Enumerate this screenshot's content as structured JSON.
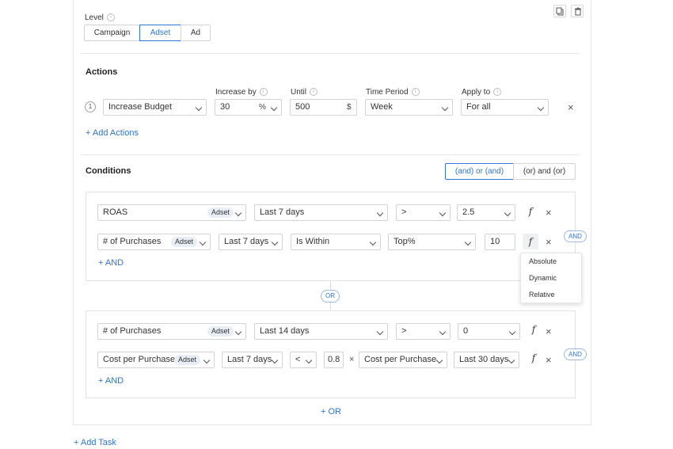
{
  "level": {
    "label": "Level",
    "options": [
      "Campaign",
      "Adset",
      "Ad"
    ],
    "selected": "Adset"
  },
  "actions": {
    "title": "Actions",
    "headers": {
      "increase_by": "Increase by",
      "until": "Until",
      "time_period": "Time Period",
      "apply_to": "Apply to"
    },
    "row": {
      "number": "1",
      "action": "Increase Budget",
      "increase_value": "30",
      "increase_unit": "%",
      "until_value": "500",
      "until_unit": "$",
      "time_period": "Week",
      "apply_to": "For all"
    },
    "add_label": "+ Add Actions"
  },
  "conditions": {
    "title": "Conditions",
    "toggle": {
      "option1": "(and) or (and)",
      "option2": "(or) and (or)",
      "selected": "(and) or (and)"
    },
    "group1": {
      "row1": {
        "metric": "ROAS",
        "badge": "Adset",
        "period": "Last 7 days",
        "operator": ">",
        "value": "2.5"
      },
      "row2": {
        "metric": "# of Purchases",
        "badge": "Adset",
        "period": "Last 7 days",
        "operator": "Is Within",
        "compare": "Top%",
        "value": "10"
      },
      "add_and": "+ AND",
      "and_pill": "AND"
    },
    "or_pill": "OR",
    "group2": {
      "row1": {
        "metric": "# of Purchases",
        "badge": "Adset",
        "period": "Last 14 days",
        "operator": ">",
        "value": "0"
      },
      "row2": {
        "metric": "Cost per Purchase",
        "badge": "Adset",
        "period": "Last 7 days",
        "operator": "<",
        "value": "0.8",
        "times": "×",
        "compare_metric": "Cost per Purchase",
        "compare_period": "Last 30 days"
      },
      "add_and": "+ AND",
      "and_pill": "AND"
    },
    "fx_menu": [
      "Absolute",
      "Dynamic",
      "Relative"
    ],
    "add_or": "+ OR"
  },
  "add_task": "+ Add Task",
  "glyphs": {
    "fx": "f",
    "close": "×",
    "info": "i"
  },
  "colors": {
    "accent": "#2f76d2",
    "border": "#cfd4d9",
    "badge_bg": "#e9eef6"
  }
}
